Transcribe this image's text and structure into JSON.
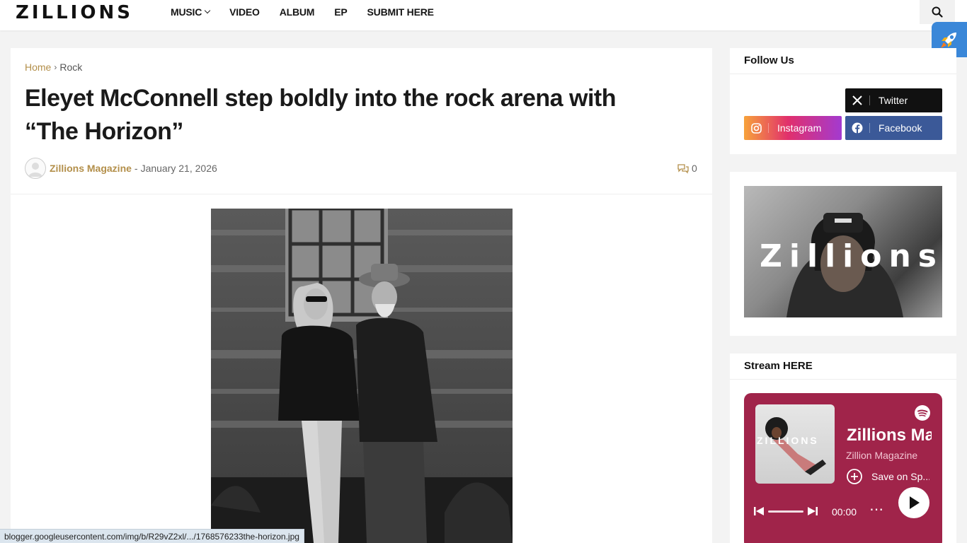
{
  "header": {
    "logo": "ZILLIONS",
    "nav": [
      {
        "label": "MUSIC",
        "has_dropdown": true
      },
      {
        "label": "VIDEO"
      },
      {
        "label": "ALBUM"
      },
      {
        "label": "EP"
      },
      {
        "label": "SUBMIT HERE"
      }
    ],
    "search_icon": "search-icon"
  },
  "article": {
    "breadcrumb": {
      "home": "Home",
      "separator": "›",
      "category": "Rock"
    },
    "title": "Eleyet McConnell step boldly into the rock arena with “The Horizon”",
    "author": "Zillions Magazine",
    "date_prefix": "-",
    "date": "January 21, 2026",
    "comment_count": "0",
    "image_alt": "Eleyet McConnell"
  },
  "sidebar": {
    "follow": {
      "title": "Follow Us",
      "buttons": [
        {
          "label": "Twitter",
          "icon": "x-icon",
          "color": "#111111"
        },
        {
          "label": "Instagram",
          "icon": "instagram-icon",
          "color": "#e1306c"
        },
        {
          "label": "Facebook",
          "icon": "facebook-icon",
          "color": "#3b5998"
        }
      ]
    },
    "banner": {
      "text": "Zillions"
    },
    "stream": {
      "title": "Stream HERE",
      "player": {
        "art_text": "ZILLIONS",
        "playlist_title": "Zillions Ma",
        "artist": "Zillion Magazine",
        "save_label": "Save on Sp...",
        "time": "00:00",
        "more": "⋯",
        "background": "#a0244a"
      }
    }
  },
  "status_url": "blogger.googleusercontent.com/img/b/R29vZ2xl/.../1768576233the-horizon.jpg",
  "colors": {
    "accent": "#b38f4a",
    "rocket": "#3a87d8"
  }
}
